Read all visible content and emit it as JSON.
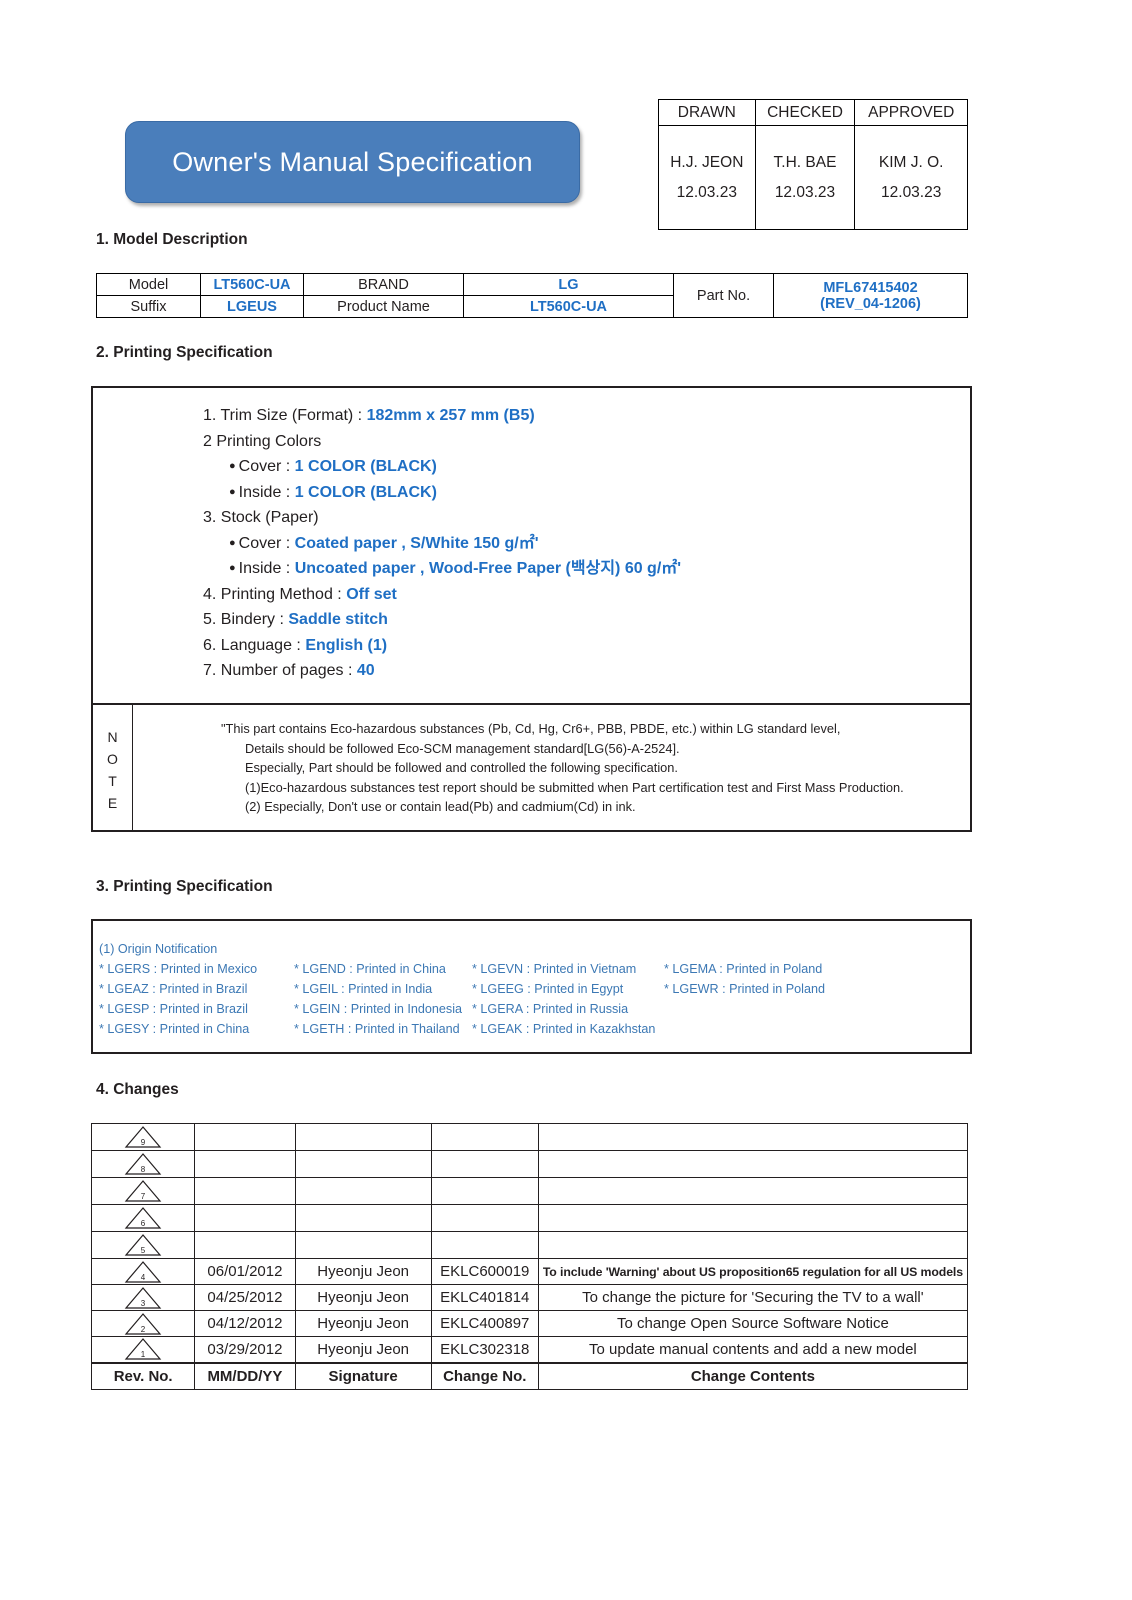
{
  "title_banner": {
    "text": "Owner's Manual Specification"
  },
  "approval_table": {
    "headers": [
      "DRAWN",
      "CHECKED",
      "APPROVED"
    ],
    "names": [
      "H.J. JEON",
      "T.H. BAE",
      "KIM J. O."
    ],
    "dates": [
      "12.03.23",
      "12.03.23",
      "12.03.23"
    ]
  },
  "sections": {
    "s1": "1. Model Description",
    "s2": "2. Printing Specification",
    "s3": "3. Printing Specification",
    "s4": "4. Changes"
  },
  "model_table": {
    "row1": {
      "label": "Model",
      "value": "LT560C-UA",
      "label2": "BRAND",
      "value2": "LG"
    },
    "row2": {
      "label": "Suffix",
      "value": "LGEUS",
      "label2": "Product Name",
      "value2": "LT560C-UA"
    },
    "part_label": "Part No.",
    "part_value_line1": "MFL67415402",
    "part_value_line2": "(REV_04-1206)"
  },
  "printing_spec": {
    "line1_label": "1. Trim Size (Format) : ",
    "line1_value": "182mm x 257 mm (B5)",
    "line2_label": "2 Printing Colors",
    "line3_label": "Cover : ",
    "line3_value": "1 COLOR (BLACK)",
    "line4_label": "Inside : ",
    "line4_value": "1 COLOR (BLACK)",
    "line5_label": "3. Stock (Paper)",
    "line6_label": "Cover : ",
    "line6_value": "Coated paper , S/White 150 g/㎡'",
    "line7_label": "Inside : ",
    "line7_value": "Uncoated paper , Wood-Free Paper (백상지) 60 g/㎡'",
    "line8_label": "4. Printing Method : ",
    "line8_value": "Off set",
    "line9_label": "5. Bindery : ",
    "line9_value": "Saddle stitch",
    "line10_label": "6. Language : ",
    "line10_value": "English (1)",
    "line11_label": "7. Number of pages : ",
    "line11_value": "40"
  },
  "note": {
    "label_letters": [
      "N",
      "O",
      "T",
      "E"
    ],
    "lines": [
      "\"This part contains Eco-hazardous substances (Pb, Cd, Hg, Cr6+, PBB, PBDE, etc.) within LG standard level,",
      "Details should be followed Eco-SCM management standard[LG(56)-A-2524].",
      "Especially, Part should be followed and controlled the following specification.",
      "(1)Eco-hazardous substances test report should be submitted when Part certification test and First Mass Production.",
      "(2) Especially, Don't use or contain lead(Pb) and cadmium(Cd) in ink."
    ]
  },
  "origin": {
    "heading": "(1) Origin Notification",
    "rows": [
      [
        "* LGERS : Printed in Mexico",
        "* LGEND : Printed in China",
        "* LGEVN : Printed in Vietnam",
        "* LGEMA : Printed in Poland"
      ],
      [
        "* LGEAZ : Printed in Brazil",
        "* LGEIL : Printed in India",
        "* LGEEG : Printed in Egypt",
        "* LGEWR : Printed in Poland"
      ],
      [
        "* LGESP : Printed in Brazil",
        "* LGEIN : Printed in Indonesia",
        "* LGERA : Printed in Russia",
        ""
      ],
      [
        "* LGESY : Printed in China",
        "* LGETH : Printed in Thailand",
        "* LGEAK : Printed in Kazakhstan",
        ""
      ]
    ]
  },
  "changes": {
    "headers": [
      "Rev. No.",
      "MM/DD/YY",
      "Signature",
      "Change No.",
      "Change Contents"
    ],
    "rows": [
      {
        "rev": "9",
        "date": "",
        "signature": "",
        "change_no": "",
        "contents": "",
        "small": false
      },
      {
        "rev": "8",
        "date": "",
        "signature": "",
        "change_no": "",
        "contents": "",
        "small": false
      },
      {
        "rev": "7",
        "date": "",
        "signature": "",
        "change_no": "",
        "contents": "",
        "small": false
      },
      {
        "rev": "6",
        "date": "",
        "signature": "",
        "change_no": "",
        "contents": "",
        "small": false
      },
      {
        "rev": "5",
        "date": "",
        "signature": "",
        "change_no": "",
        "contents": "",
        "small": false
      },
      {
        "rev": "4",
        "date": "06/01/2012",
        "signature": "Hyeonju Jeon",
        "change_no": "EKLC600019",
        "contents": "To include 'Warning' about US proposition65 regulation for all US models",
        "small": true
      },
      {
        "rev": "3",
        "date": "04/25/2012",
        "signature": "Hyeonju Jeon",
        "change_no": "EKLC401814",
        "contents": "To change the picture for 'Securing the TV to a wall'",
        "small": false
      },
      {
        "rev": "2",
        "date": "04/12/2012",
        "signature": "Hyeonju Jeon",
        "change_no": "EKLC400897",
        "contents": "To change Open Source Software Notice",
        "small": false
      },
      {
        "rev": "1",
        "date": "03/29/2012",
        "signature": "Hyeonju Jeon",
        "change_no": "EKLC302318",
        "contents": "To update manual contents and add a new model",
        "small": false
      }
    ]
  },
  "colors": {
    "banner_blue": "#4a7ebb",
    "text_blue": "#1f6fc4",
    "origin_blue": "#3c78b4",
    "ink": "#231f20"
  }
}
